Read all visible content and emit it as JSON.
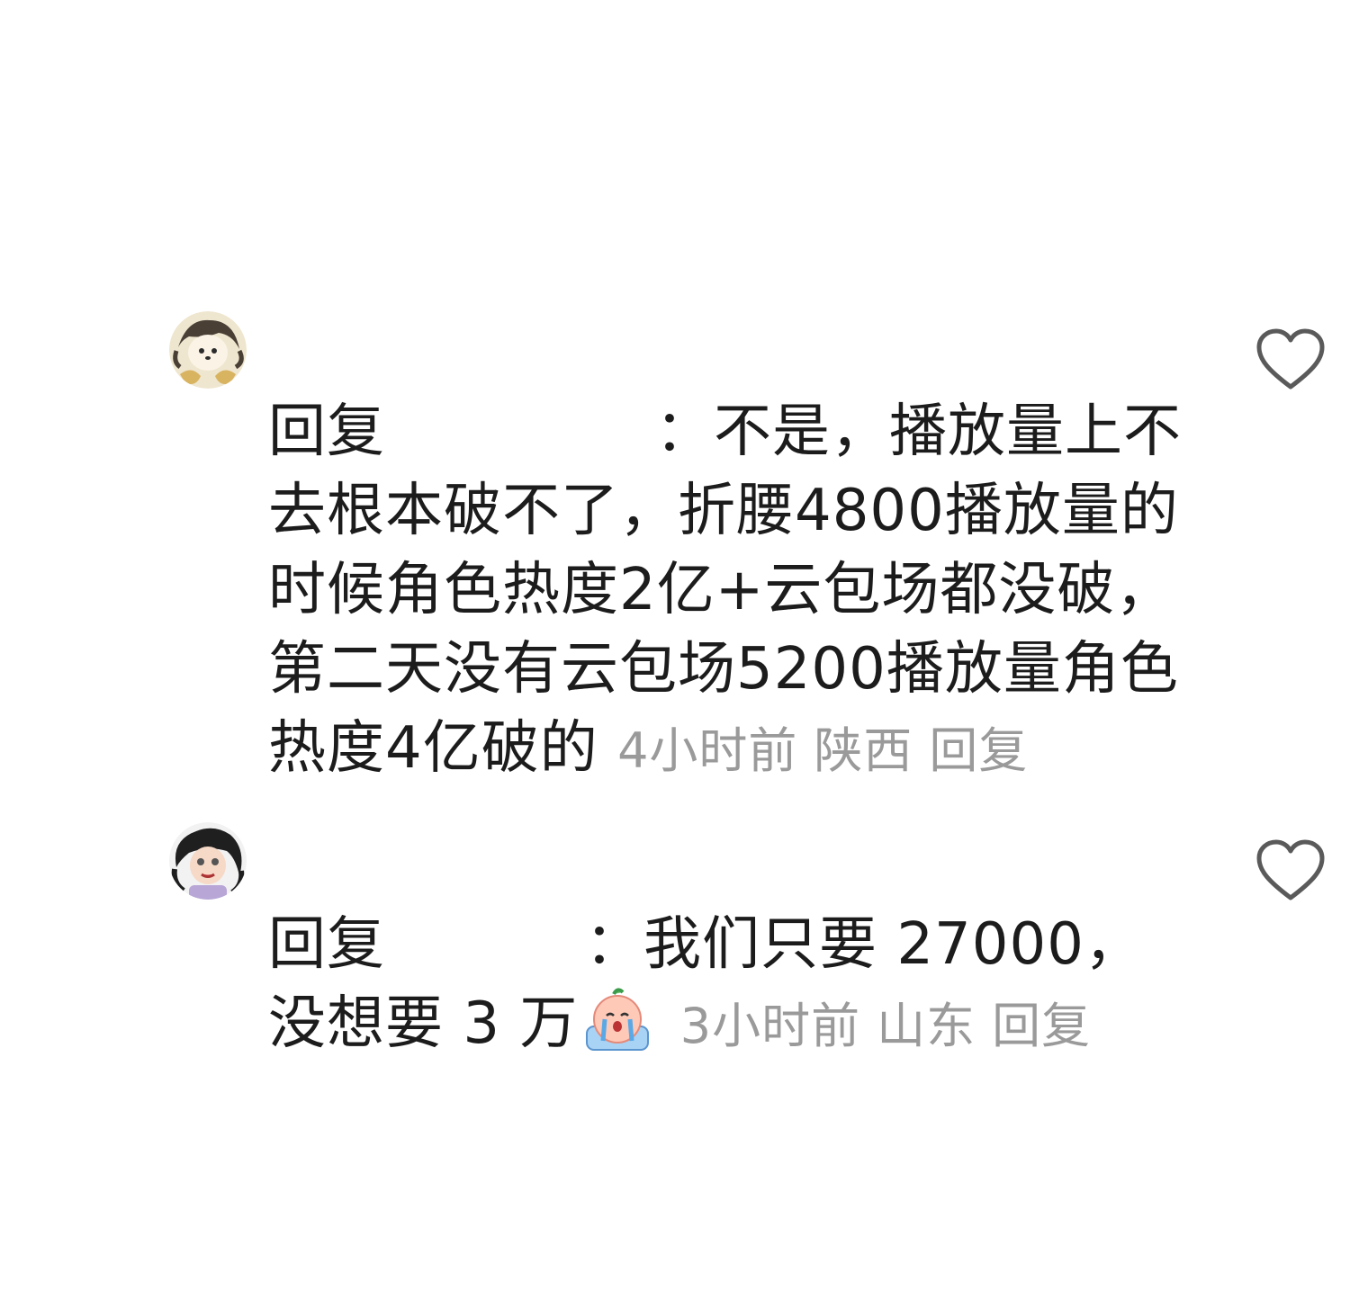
{
  "comments": [
    {
      "reply_prefix": "回复",
      "colon": "：",
      "text": "不是，播放量上不去根本破不了，折腰4800播放量的时候角色热度2亿+云包场都没破，第二天没有云包场5200播放量角色热度4亿破的",
      "time": "4小时前",
      "location": "陕西",
      "reply_label": "回复",
      "avatar_icon": "avatar-cartoon-boy-icon"
    },
    {
      "reply_prefix": "回复",
      "colon": "：",
      "text": "我们只要 27000，没想要 3 万",
      "emoji_icon": "crying-emoji-icon",
      "time": "3小时前",
      "location": "山东",
      "reply_label": "回复",
      "avatar_icon": "avatar-cartoon-girl-icon"
    }
  ],
  "colors": {
    "text": "#1c1c1c",
    "meta": "#9a9a9a",
    "heart_stroke": "#5a5a5a"
  }
}
